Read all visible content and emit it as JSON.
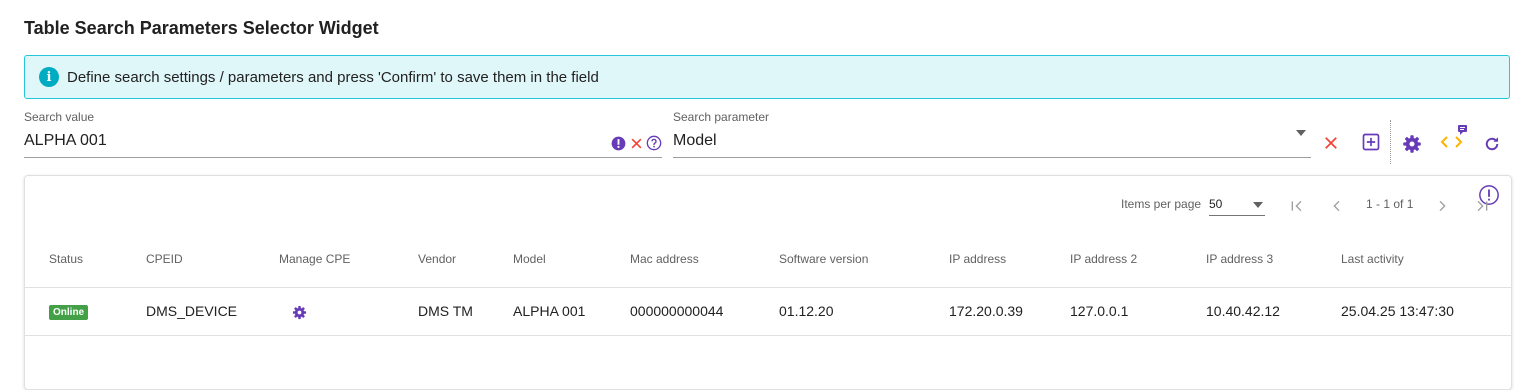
{
  "title": "Table Search Parameters Selector Widget",
  "info_banner": {
    "icon": "info-icon",
    "text": "Define search settings / parameters and press 'Confirm' to save them in the field"
  },
  "search_value": {
    "label": "Search value",
    "value": "ALPHA 001"
  },
  "search_parameter": {
    "label": "Search parameter",
    "value": "Model"
  },
  "paginator": {
    "items_per_page_label": "Items per page",
    "page_size": "50",
    "range": "1 - 1 of 1"
  },
  "table": {
    "headers": [
      "Status",
      "CPEID",
      "Manage CPE",
      "Vendor",
      "Model",
      "Mac address",
      "Software version",
      "IP address",
      "IP address 2",
      "IP address 3",
      "Last activity"
    ],
    "rows": [
      {
        "status": "Online",
        "cpeid": "DMS_DEVICE",
        "manage_icon": "gear-icon",
        "vendor": "DMS TM",
        "model": "ALPHA 001",
        "mac": "000000000044",
        "software": "01.12.20",
        "ip1": "172.20.0.39",
        "ip2": "127.0.0.1",
        "ip3": "10.40.42.12",
        "last_activity": "25.04.25 13:47:30"
      }
    ]
  },
  "colors": {
    "accent": "#673ab7",
    "danger": "#f44336",
    "warning": "#ffb300",
    "info_bg": "#e0f7fa",
    "info_border": "#26c6da",
    "online": "#43a047"
  }
}
